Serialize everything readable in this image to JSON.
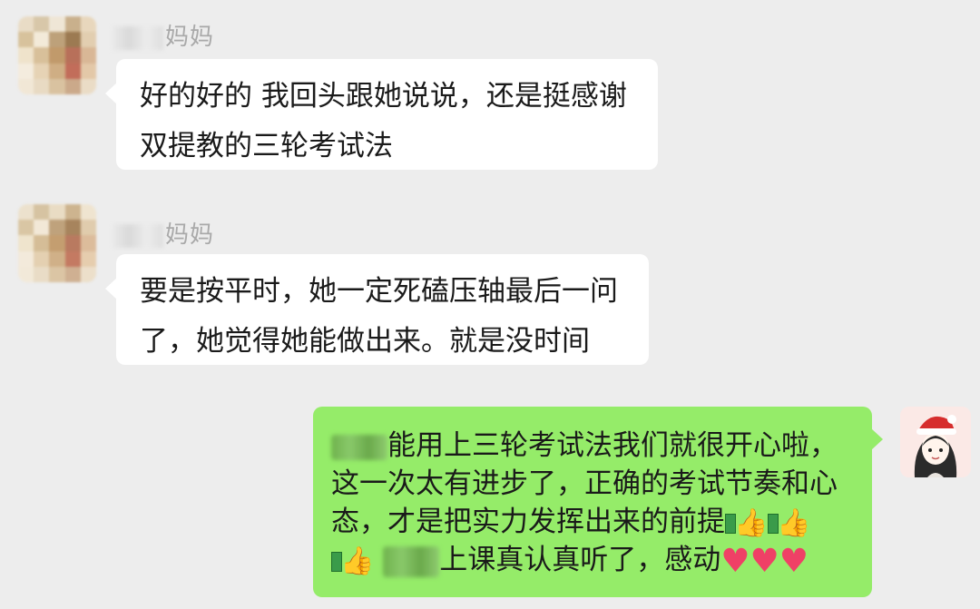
{
  "messages": [
    {
      "side": "left",
      "sender_suffix": "妈妈",
      "lines": [
        "好的好的 我回头跟她说说，还是挺感谢",
        "双提教的三轮考试法"
      ]
    },
    {
      "side": "left",
      "sender_suffix": "妈妈",
      "lines": [
        "要是按平时，她一定死磕压轴最后一问",
        "了，她觉得她能做出来。就是没时间"
      ]
    },
    {
      "side": "right",
      "line1": "能用上三轮考试法我们就很开心啦，",
      "line2": "这一次太有进步了，正确的考试节奏和心",
      "line3": "态，才是把实力发挥出来的前提",
      "line4": "上课真认真听了，感动"
    }
  ],
  "emoji": {
    "thumbs_up": "👍",
    "heart": "♥"
  },
  "colors": {
    "background": "#ededed",
    "incoming_bubble": "#ffffff",
    "outgoing_bubble": "#95ec69"
  }
}
